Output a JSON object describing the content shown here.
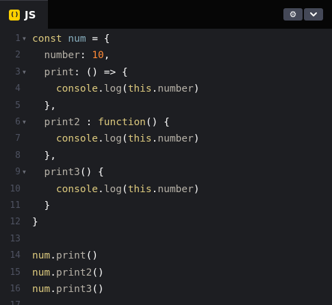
{
  "editor_tab": {
    "icon": "( )",
    "label": "JS"
  },
  "header_buttons": {
    "settings_icon": "⚙",
    "chevron_icon": "⌄"
  },
  "code_lines": [
    {
      "n": "1",
      "fold": true,
      "tokens": [
        [
          "const",
          "kw"
        ],
        [
          " ",
          "p"
        ],
        [
          "num",
          "var"
        ],
        [
          " = {",
          "p"
        ]
      ]
    },
    {
      "n": "2",
      "fold": false,
      "tokens": [
        [
          "  ",
          "p"
        ],
        [
          "number",
          "prop"
        ],
        [
          ": ",
          "p"
        ],
        [
          "10",
          "num"
        ],
        [
          ",",
          "p"
        ]
      ]
    },
    {
      "n": "3",
      "fold": true,
      "tokens": [
        [
          "  ",
          "p"
        ],
        [
          "print",
          "prop"
        ],
        [
          ": () => {",
          "p"
        ]
      ]
    },
    {
      "n": "4",
      "fold": false,
      "tokens": [
        [
          "    ",
          "p"
        ],
        [
          "console",
          "fn"
        ],
        [
          ".",
          "p"
        ],
        [
          "log",
          "prop"
        ],
        [
          "(",
          "p"
        ],
        [
          "this",
          "fn"
        ],
        [
          ".",
          "p"
        ],
        [
          "number",
          "prop"
        ],
        [
          ")",
          "p"
        ]
      ]
    },
    {
      "n": "5",
      "fold": false,
      "tokens": [
        [
          "  },",
          "p"
        ]
      ]
    },
    {
      "n": "6",
      "fold": true,
      "tokens": [
        [
          "  ",
          "p"
        ],
        [
          "print2",
          "prop"
        ],
        [
          " : ",
          "p"
        ],
        [
          "function",
          "kw"
        ],
        [
          "() {",
          "p"
        ]
      ]
    },
    {
      "n": "7",
      "fold": false,
      "tokens": [
        [
          "    ",
          "p"
        ],
        [
          "console",
          "fn"
        ],
        [
          ".",
          "p"
        ],
        [
          "log",
          "prop"
        ],
        [
          "(",
          "p"
        ],
        [
          "this",
          "fn"
        ],
        [
          ".",
          "p"
        ],
        [
          "number",
          "prop"
        ],
        [
          ")",
          "p"
        ]
      ]
    },
    {
      "n": "8",
      "fold": false,
      "tokens": [
        [
          "  },",
          "p"
        ]
      ]
    },
    {
      "n": "9",
      "fold": true,
      "tokens": [
        [
          "  ",
          "p"
        ],
        [
          "print3",
          "prop"
        ],
        [
          "() {",
          "p"
        ]
      ]
    },
    {
      "n": "10",
      "fold": false,
      "tokens": [
        [
          "    ",
          "p"
        ],
        [
          "console",
          "fn"
        ],
        [
          ".",
          "p"
        ],
        [
          "log",
          "prop"
        ],
        [
          "(",
          "p"
        ],
        [
          "this",
          "fn"
        ],
        [
          ".",
          "p"
        ],
        [
          "number",
          "prop"
        ],
        [
          ")",
          "p"
        ]
      ]
    },
    {
      "n": "11",
      "fold": false,
      "tokens": [
        [
          "  }",
          "p"
        ]
      ]
    },
    {
      "n": "12",
      "fold": false,
      "tokens": [
        [
          "}",
          "p"
        ]
      ]
    },
    {
      "n": "13",
      "fold": false,
      "tokens": []
    },
    {
      "n": "14",
      "fold": false,
      "tokens": [
        [
          "num",
          "kw"
        ],
        [
          ".",
          "p"
        ],
        [
          "print",
          "prop"
        ],
        [
          "()",
          "p"
        ]
      ]
    },
    {
      "n": "15",
      "fold": false,
      "tokens": [
        [
          "num",
          "kw"
        ],
        [
          ".",
          "p"
        ],
        [
          "print2",
          "prop"
        ],
        [
          "()",
          "p"
        ]
      ]
    },
    {
      "n": "16",
      "fold": false,
      "tokens": [
        [
          "num",
          "kw"
        ],
        [
          ".",
          "p"
        ],
        [
          "print3",
          "prop"
        ],
        [
          "()",
          "p"
        ]
      ]
    },
    {
      "n": "17",
      "fold": false,
      "tokens": []
    }
  ]
}
